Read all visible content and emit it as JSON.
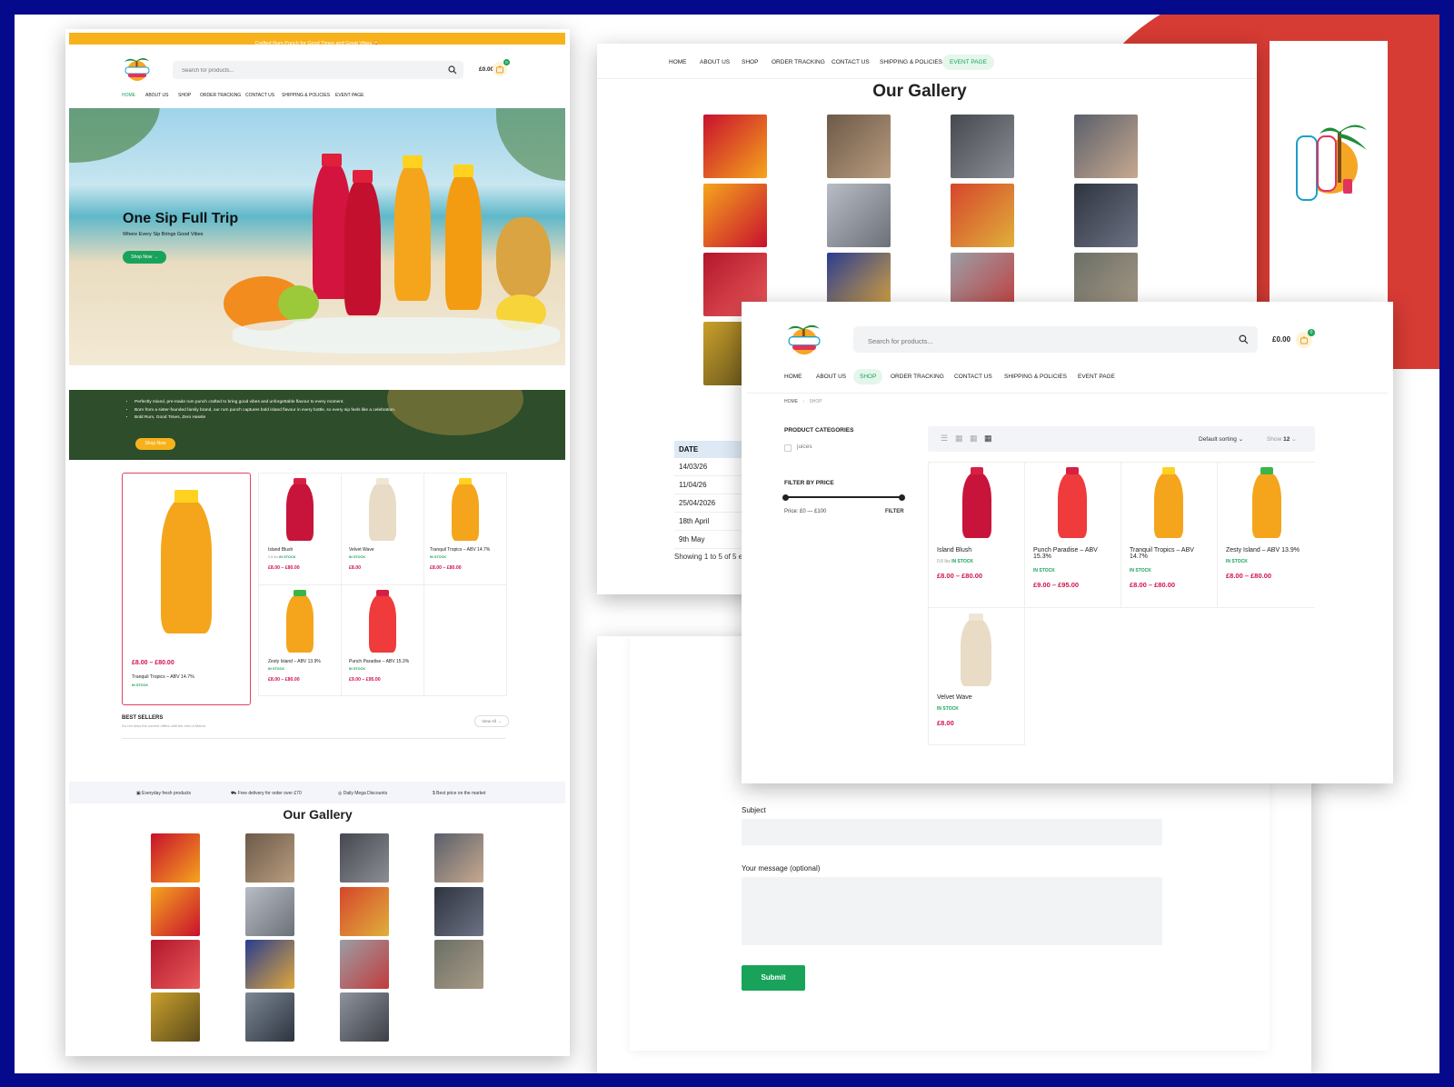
{
  "colors": {
    "frame": "#050a8c",
    "accent_red": "#d63b34",
    "brand_green": "#19a35a",
    "price_red": "#d0134a",
    "promo_yellow": "#f7b21b",
    "banner_dark_green": "#2e4d2a"
  },
  "home": {
    "promo_text": "Crafted Rum Punch for Good Times and Great Vibes 🍹",
    "search_placeholder": "Search for products...",
    "cart_total": "£0.00",
    "cart_count": "0",
    "nav": [
      "HOME",
      "ABOUT US",
      "SHOP",
      "ORDER TRACKING",
      "CONTACT US",
      "SHIPPING & POLICIES",
      "EVENT PAGE"
    ],
    "hero": {
      "title": "One Sip Full Trip",
      "subtitle": "Where Every Sip Brings Good Vibes",
      "cta": "Shop Now"
    },
    "info_bullets": [
      "Perfectly mixed, pre-made rum punch crafted to bring good vibes and unforgettable flavour to every moment.",
      "Born from a sister-founded family brand, our rum punch captures bold island flavour in every bottle, so every sip feels like a celebration.",
      "Bold Rum, Good Times, Zero Hassle"
    ],
    "info_cta": "Shop Now",
    "featured": {
      "price": "£8.00 – £80.00",
      "name": "Tranquil Tropics – ABV 14.7%",
      "stock": "IN STOCK"
    },
    "products": [
      {
        "name": "Island Blush",
        "meta": "0.8 lbs",
        "stock": "IN STOCK",
        "price": "£8.00 – £80.00"
      },
      {
        "name": "Velvet Wave",
        "stock": "IN STOCK",
        "price": "£8.00"
      },
      {
        "name": "Tranquil Tropics – ABV 14.7%",
        "stock": "IN STOCK",
        "price": "£8.00 – £80.00"
      },
      {
        "name": "Zesty Island – ABV 13.9%",
        "stock": "IN STOCK",
        "price": "£8.00 – £80.00"
      },
      {
        "name": "Punch Paradise – ABV 15.3%",
        "stock": "IN STOCK",
        "price": "£9.00 – £95.00"
      }
    ],
    "best_sellers": {
      "title": "BEST SELLERS",
      "subtitle": "Do not miss the current offers until the end of March.",
      "view_all": "View All"
    },
    "features": [
      "Everyday fresh products",
      "Free delivery for order over £70",
      "Daily Mega Discounts",
      "Best price on the market"
    ],
    "gallery_title": "Our Gallery"
  },
  "gallery_page": {
    "nav": [
      "HOME",
      "ABOUT US",
      "SHOP",
      "ORDER TRACKING",
      "CONTACT US",
      "SHIPPING & POLICIES",
      "EVENT PAGE"
    ],
    "title": "Our Gallery",
    "events_header": "DATE",
    "events": [
      "14/03/26",
      "11/04/26",
      "25/04/2026",
      "18th April",
      "9th May"
    ],
    "showing": "Showing 1 to 5 of 5 e"
  },
  "shop_page": {
    "search_placeholder": "Search for products...",
    "cart_total": "£0.00",
    "cart_count": "0",
    "nav": [
      "HOME",
      "ABOUT US",
      "SHOP",
      "ORDER TRACKING",
      "CONTACT US",
      "SHIPPING & POLICIES",
      "EVENT PAGE"
    ],
    "breadcrumb": [
      "HOME",
      "SHOP"
    ],
    "categories_title": "PRODUCT CATEGORIES",
    "category": "juices",
    "filter_title": "FILTER BY PRICE",
    "price_range": "Price: £0 — £100",
    "filter_button": "FILTER",
    "sorting": "Default sorting",
    "show_label": "Show",
    "show_value": "12",
    "products": [
      {
        "name": "Island Blush",
        "meta": "0.8 lbs",
        "stock": "IN STOCK",
        "price": "£8.00 – £80.00"
      },
      {
        "name": "Punch Paradise – ABV 15.3%",
        "stock": "IN STOCK",
        "price": "£9.00 – £95.00"
      },
      {
        "name": "Tranquil Tropics – ABV 14.7%",
        "stock": "IN STOCK",
        "price": "£8.00 – £80.00"
      },
      {
        "name": "Zesty Island – ABV 13.9%",
        "stock": "IN STOCK",
        "price": "£8.00 – £80.00"
      },
      {
        "name": "Velvet Wave",
        "stock": "IN STOCK",
        "price": "£8.00"
      }
    ]
  },
  "contact_page": {
    "subject_label": "Subject",
    "message_label": "Your message (optional)",
    "submit": "Submit"
  }
}
